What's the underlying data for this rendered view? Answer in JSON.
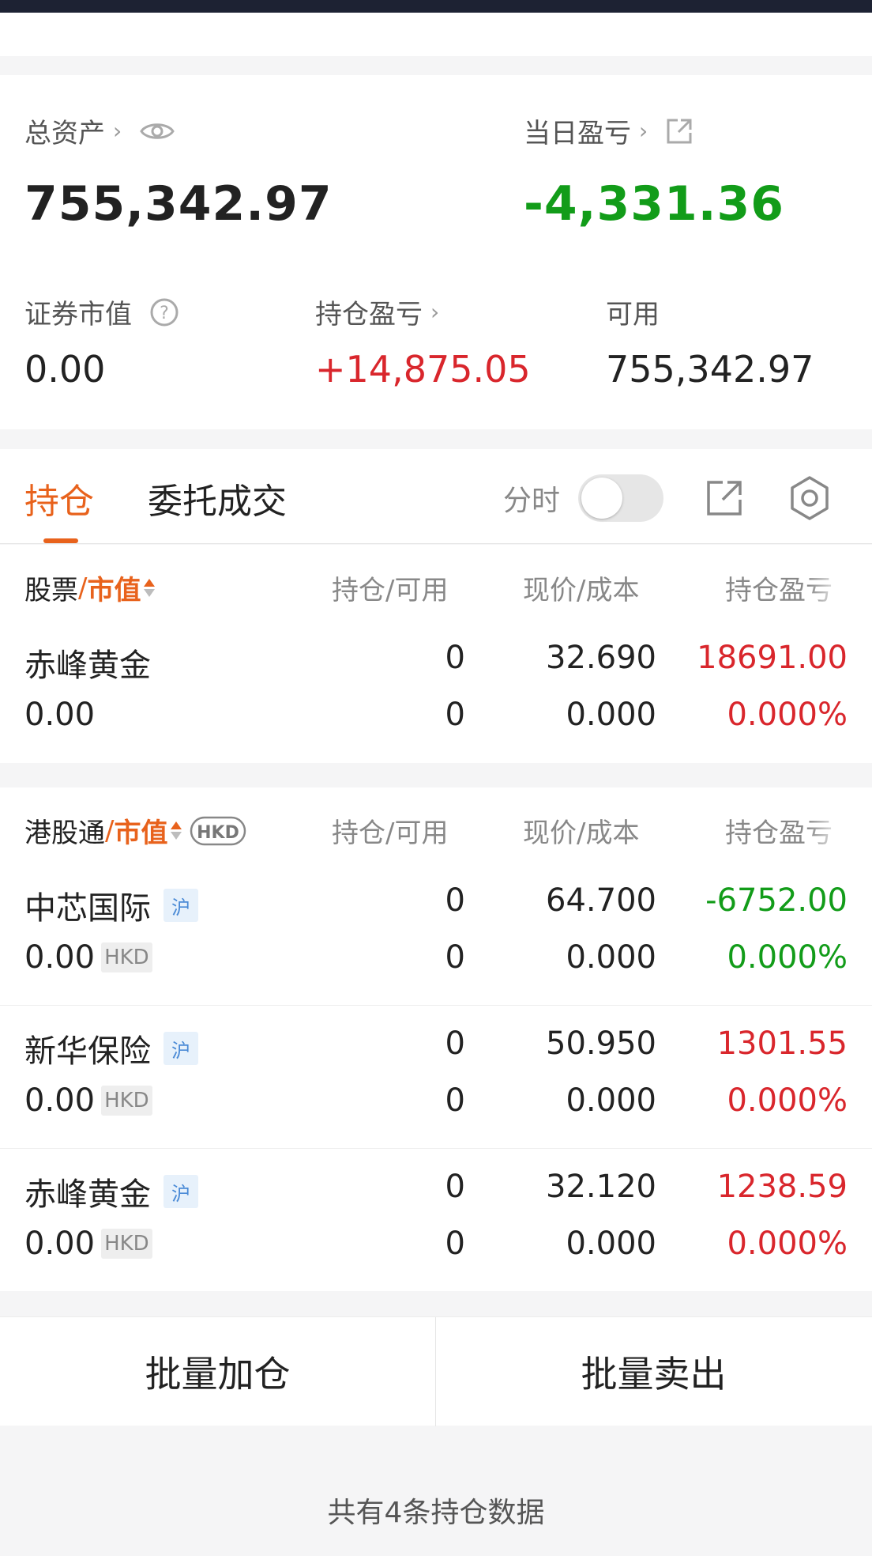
{
  "summary": {
    "total_assets_label": "总资产",
    "total_assets_value": "755,342.97",
    "daily_pnl_label": "当日盈亏",
    "daily_pnl_value": "-4,331.36",
    "securities_mv_label": "证券市值",
    "securities_mv_value": "0.00",
    "position_pnl_label": "持仓盈亏",
    "position_pnl_value": "+14,875.05",
    "available_label": "可用",
    "available_value": "755,342.97"
  },
  "tabs": {
    "positions": "持仓",
    "orders": "委托成交",
    "intraday_label": "分时",
    "intraday_on": false
  },
  "stocks_section": {
    "header": {
      "first": "股票",
      "separator": "/",
      "market_value": "市值",
      "col_position": "持仓/可用",
      "col_price": "现价/成本",
      "col_pnl": "持仓盈亏"
    },
    "rows": [
      {
        "name": "赤峰黄金",
        "market_value": "0.00",
        "position": "0",
        "available": "0",
        "price": "32.690",
        "cost": "0.000",
        "pnl": "18691.00",
        "pnl_pct": "0.000%",
        "trend": "up"
      }
    ]
  },
  "hk_section": {
    "header": {
      "first": "港股通",
      "separator": "/",
      "market_value": "市值",
      "currency_badge": "HKD",
      "col_position": "持仓/可用",
      "col_price": "现价/成本",
      "col_pnl": "持仓盈亏"
    },
    "rows": [
      {
        "name": "中芯国际",
        "tag": "沪",
        "market_value": "0.00",
        "currency": "HKD",
        "position": "0",
        "available": "0",
        "price": "64.700",
        "cost": "0.000",
        "pnl": "-6752.00",
        "pnl_pct": "0.000%",
        "trend": "down"
      },
      {
        "name": "新华保险",
        "tag": "沪",
        "market_value": "0.00",
        "currency": "HKD",
        "position": "0",
        "available": "0",
        "price": "50.950",
        "cost": "0.000",
        "pnl": "1301.55",
        "pnl_pct": "0.000%",
        "trend": "up"
      },
      {
        "name": "赤峰黄金",
        "tag": "沪",
        "market_value": "0.00",
        "currency": "HKD",
        "position": "0",
        "available": "0",
        "price": "32.120",
        "cost": "0.000",
        "pnl": "1238.59",
        "pnl_pct": "0.000%",
        "trend": "up"
      }
    ]
  },
  "actions": {
    "batch_add": "批量加仓",
    "batch_sell": "批量卖出"
  },
  "footer": "共有4条持仓数据",
  "colors": {
    "accent": "#e8621c",
    "up": "#d9262c",
    "down": "#129c19"
  },
  "icons": {
    "eye": "eye-icon",
    "share": "external-link-icon",
    "help": "help-circle-icon",
    "export": "export-icon",
    "settings": "gear-icon"
  }
}
